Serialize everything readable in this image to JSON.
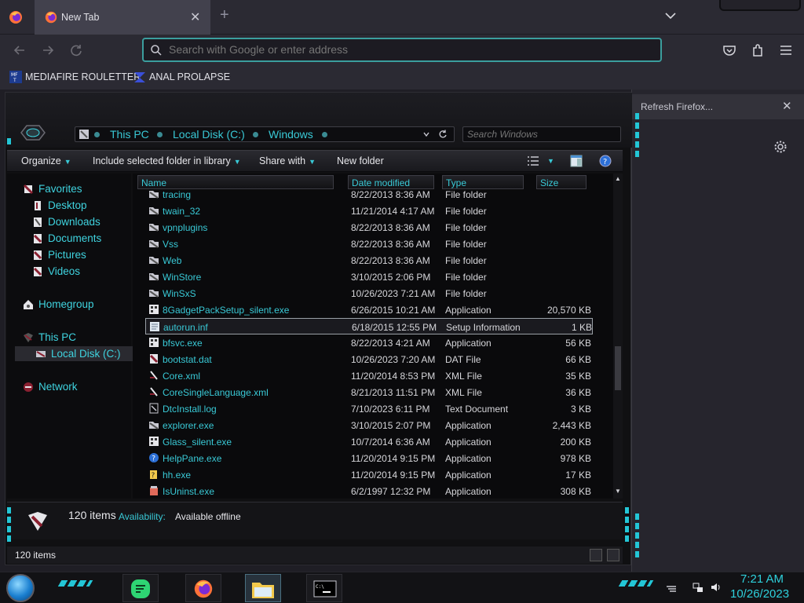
{
  "browser": {
    "tab": {
      "title": "New Tab"
    },
    "url_placeholder": "Search with Google or enter address",
    "bookmarks": [
      {
        "label": "MEDIAFIRE ROULETTER"
      },
      {
        "label": "ANAL PROLAPSE"
      }
    ],
    "sidebar": {
      "notification": "Refresh Firefox..."
    }
  },
  "explorer": {
    "breadcrumbs": [
      "This PC",
      "Local Disk (C:)",
      "Windows"
    ],
    "search_placeholder": "Search Windows",
    "commands": {
      "organize": "Organize",
      "include": "Include selected folder in library",
      "share": "Share with",
      "new_folder": "New folder"
    },
    "nav": {
      "favorites": "Favorites",
      "desktop": "Desktop",
      "downloads": "Downloads",
      "documents": "Documents",
      "pictures": "Pictures",
      "videos": "Videos",
      "homegroup": "Homegroup",
      "this_pc": "This PC",
      "local_disk": "Local Disk (C:)",
      "network": "Network"
    },
    "columns": {
      "name": "Name",
      "date": "Date modified",
      "type": "Type",
      "size": "Size"
    },
    "rows": [
      {
        "name": "tracing",
        "date": "8/22/2013 8:36 AM",
        "type": "File folder",
        "size": "",
        "icon": "folder"
      },
      {
        "name": "twain_32",
        "date": "11/21/2014 4:17 AM",
        "type": "File folder",
        "size": "",
        "icon": "folder"
      },
      {
        "name": "vpnplugins",
        "date": "8/22/2013 8:36 AM",
        "type": "File folder",
        "size": "",
        "icon": "folder"
      },
      {
        "name": "Vss",
        "date": "8/22/2013 8:36 AM",
        "type": "File folder",
        "size": "",
        "icon": "folder"
      },
      {
        "name": "Web",
        "date": "8/22/2013 8:36 AM",
        "type": "File folder",
        "size": "",
        "icon": "folder"
      },
      {
        "name": "WinStore",
        "date": "3/10/2015 2:06 PM",
        "type": "File folder",
        "size": "",
        "icon": "folder"
      },
      {
        "name": "WinSxS",
        "date": "10/26/2023 7:21 AM",
        "type": "File folder",
        "size": "",
        "icon": "folder"
      },
      {
        "name": "8GadgetPackSetup_silent.exe",
        "date": "6/26/2015 10:21 AM",
        "type": "Application",
        "size": "20,570 KB",
        "icon": "app"
      },
      {
        "name": "autorun.inf",
        "date": "6/18/2015 12:55 PM",
        "type": "Setup Information",
        "size": "1 KB",
        "icon": "setup"
      },
      {
        "name": "bfsvc.exe",
        "date": "8/22/2013 4:21 AM",
        "type": "Application",
        "size": "56 KB",
        "icon": "app"
      },
      {
        "name": "bootstat.dat",
        "date": "10/26/2023 7:20 AM",
        "type": "DAT File",
        "size": "66 KB",
        "icon": "dat"
      },
      {
        "name": "Core.xml",
        "date": "11/20/2014 8:53 PM",
        "type": "XML File",
        "size": "35 KB",
        "icon": "xml"
      },
      {
        "name": "CoreSingleLanguage.xml",
        "date": "8/21/2013 11:51 PM",
        "type": "XML File",
        "size": "36 KB",
        "icon": "xml"
      },
      {
        "name": "DtcInstall.log",
        "date": "7/10/2023 6:11 PM",
        "type": "Text Document",
        "size": "3 KB",
        "icon": "text"
      },
      {
        "name": "explorer.exe",
        "date": "3/10/2015 2:07 PM",
        "type": "Application",
        "size": "2,443 KB",
        "icon": "folder"
      },
      {
        "name": "Glass_silent.exe",
        "date": "10/7/2014 6:36 AM",
        "type": "Application",
        "size": "200 KB",
        "icon": "app"
      },
      {
        "name": "HelpPane.exe",
        "date": "11/20/2014 9:15 PM",
        "type": "Application",
        "size": "978 KB",
        "icon": "help"
      },
      {
        "name": "hh.exe",
        "date": "11/20/2014 9:15 PM",
        "type": "Application",
        "size": "17 KB",
        "icon": "help-doc"
      },
      {
        "name": "IsUninst.exe",
        "date": "6/2/1997 12:32 PM",
        "type": "Application",
        "size": "308 KB",
        "icon": "uninstall"
      }
    ],
    "details": {
      "count": "120 items",
      "availability_label": "Availability:",
      "availability_value": "Available offline"
    },
    "status": "120 items"
  },
  "taskbar": {
    "time": "7:21 AM",
    "date": "10/26/2023"
  },
  "colors": {
    "accent": "#39c9d6",
    "highlight_border": "#9aa0a6",
    "firefox_urlbar_border": "#3b9e9e"
  }
}
